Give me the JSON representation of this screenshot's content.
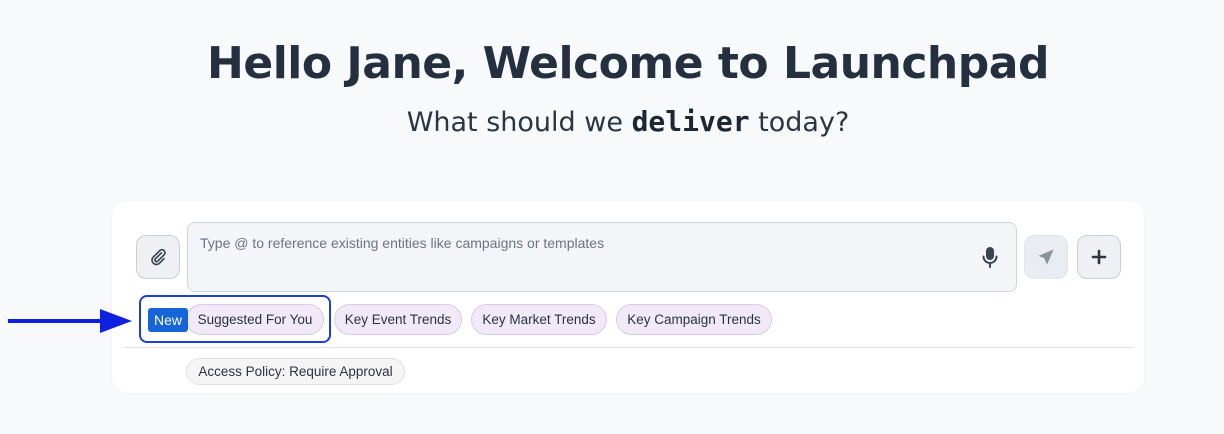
{
  "hero": {
    "greeting": "Hello Jane, Welcome to Launchpad",
    "sub_prefix": "What should we",
    "sub_keyword": "deliver",
    "sub_suffix": "today?"
  },
  "composer": {
    "placeholder": "Type @ to reference existing entities like campaigns or templates",
    "value": ""
  },
  "icons": {
    "attach": "paperclip-icon",
    "mic": "microphone-icon",
    "send": "paper-plane-icon",
    "add": "plus-icon"
  },
  "badge": {
    "new_label": "New"
  },
  "chips": [
    "Suggested For You",
    "Key Event Trends",
    "Key Market Trends",
    "Key Campaign Trends"
  ],
  "policy": {
    "label": "Access Policy: Require Approval"
  },
  "colors": {
    "background": "#f8f9fb",
    "title": "#243040",
    "badge": "#1565d8",
    "chip_fill": "#f1e9f8",
    "annotation": "#1020e0"
  }
}
